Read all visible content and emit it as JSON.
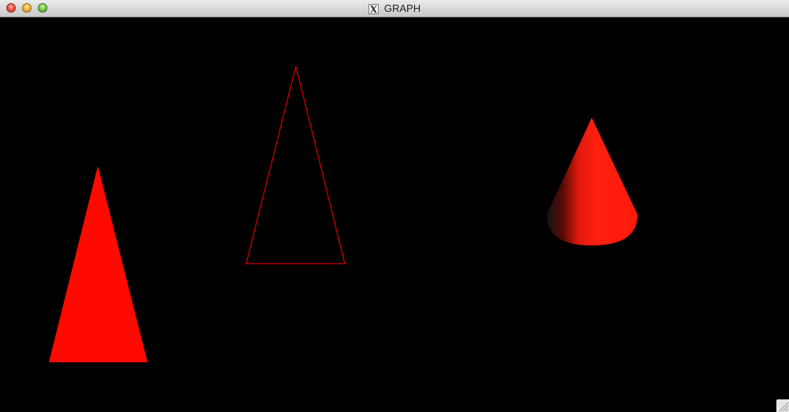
{
  "window": {
    "title": "GRAPH",
    "controls": [
      "close",
      "minimize",
      "zoom"
    ]
  },
  "app_icon": "x11-icon",
  "colors": {
    "background": "#000000",
    "shape_red": "#ff0a00",
    "outline_red": "#ff0000",
    "cone_shadow": "#1a1a1a"
  },
  "scene": {
    "shapes": [
      {
        "kind": "filled-triangle",
        "style": "solid"
      },
      {
        "kind": "outlined-triangle",
        "style": "wireframe"
      },
      {
        "kind": "shaded-cone",
        "style": "gradient-lit"
      }
    ]
  }
}
